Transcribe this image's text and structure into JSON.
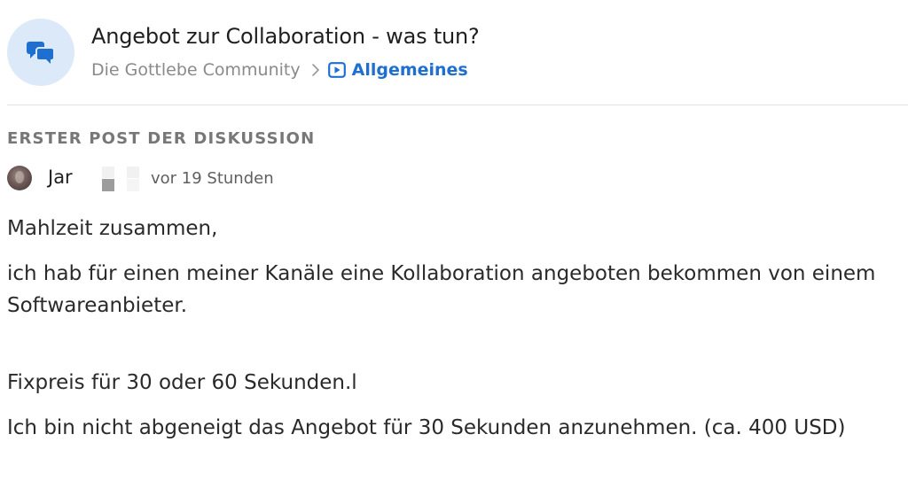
{
  "thread": {
    "title": "Angebot zur Collaboration - was tun?",
    "icon": "chat-bubbles-icon"
  },
  "breadcrumb": {
    "community": "Die Gottlebe Community",
    "separator_icon": "chevron-right-icon",
    "category_icon": "video-play-icon",
    "category": "Allgemeines"
  },
  "post": {
    "section_label": "ERSTER POST DER DISKUSSION",
    "author": "Jar",
    "time": "vor 19 Stunden",
    "paragraphs": [
      "Mahlzeit zusammen,",
      "ich hab für einen meiner Kanäle eine Kollaboration angeboten bekommen von einem Softwareanbieter.",
      "Fixpreis für 30 oder 60 Sekunden.l",
      "Ich bin nicht abgeneigt das Angebot für 30 Sekunden anzunehmen. (ca. 400 USD)"
    ]
  },
  "colors": {
    "accent": "#1e6fd0",
    "icon_bg": "#dce9f8",
    "muted": "#8a8a8a"
  }
}
